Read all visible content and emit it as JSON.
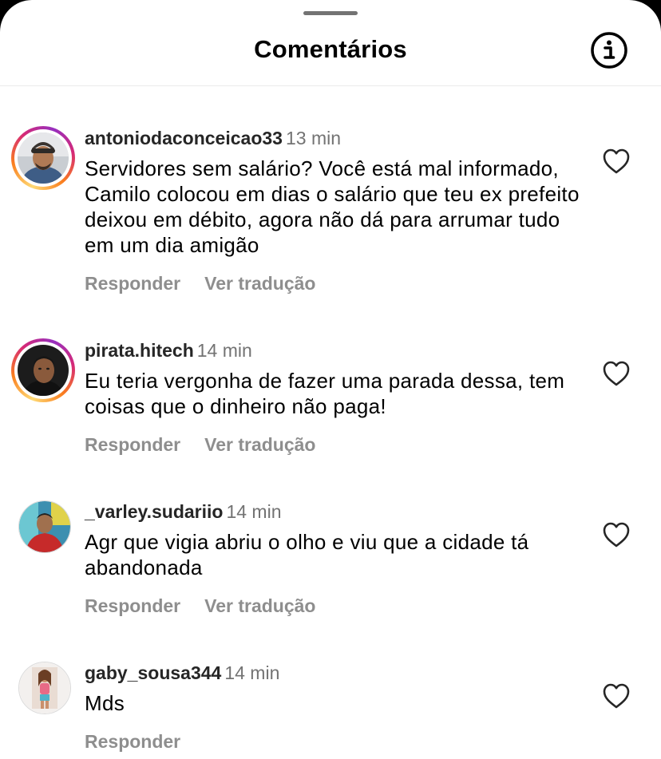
{
  "header": {
    "title": "Comentários",
    "info_icon": "info-circle-icon"
  },
  "comments": [
    {
      "username": "antoniodaconceicao33",
      "time": "13 min",
      "text": "Servidores sem salário? Você está mal informado, Camilo colocou em dias o salário que teu ex prefeito deixou em débito, agora não dá para arrumar tudo em um dia amigão",
      "reply_label": "Responder",
      "translate_label": "Ver tradução",
      "story_ring": true
    },
    {
      "username": "pirata.hitech",
      "time": "14 min",
      "text": "Eu teria vergonha de fazer uma parada dessa, tem coisas que o dinheiro não paga!",
      "reply_label": "Responder",
      "translate_label": "Ver tradução",
      "story_ring": true
    },
    {
      "username": "_varley.sudariio",
      "time": "14 min",
      "text": "Agr que vigia abriu o olho e viu que a cidade tá abandonada",
      "reply_label": "Responder",
      "translate_label": "Ver tradução",
      "story_ring": false
    },
    {
      "username": "gaby_sousa344",
      "time": "14 min",
      "text": "Mds",
      "reply_label": "Responder",
      "story_ring": false
    }
  ],
  "colors": {
    "username": "#262626",
    "secondary": "#737373",
    "action": "#8e8e8e",
    "ring_gradient": [
      "#feda75",
      "#fa7e1e",
      "#d62976",
      "#962fbf"
    ]
  }
}
